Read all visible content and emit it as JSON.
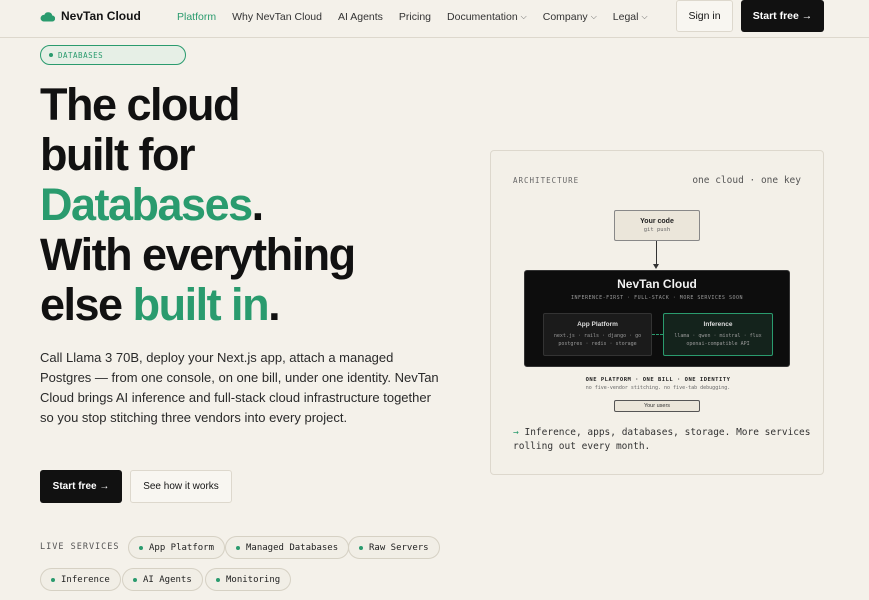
{
  "nav": {
    "logo": "NevTan Cloud",
    "links": [
      {
        "label": "Platform",
        "active": true,
        "dropdown": false
      },
      {
        "label": "Why NevTan Cloud",
        "active": false,
        "dropdown": false
      },
      {
        "label": "AI Agents",
        "active": false,
        "dropdown": false
      },
      {
        "label": "Pricing",
        "active": false,
        "dropdown": false
      },
      {
        "label": "Documentation",
        "active": false,
        "dropdown": true
      },
      {
        "label": "Company",
        "active": false,
        "dropdown": true
      },
      {
        "label": "Legal",
        "active": false,
        "dropdown": true
      }
    ],
    "signin": "Sign in",
    "start": "Start free →"
  },
  "hero": {
    "tag": "DATABASES",
    "h_line1": "The cloud",
    "h_line2": "built for",
    "h_accent": "Databases",
    "h_period": ".",
    "h_line4": "With everything",
    "h_line5a": "else ",
    "h_line5b": "built in",
    "h_line5c": ".",
    "description": "Call Llama 3 70B, deploy your Next.js app, attach a managed Postgres — from one console, on one bill, under one identity. NevTan Cloud brings AI inference and full-stack cloud infrastructure together so you stop stitching three vendors into every project.",
    "cta_primary": "Start free →",
    "cta_secondary": "See how it works",
    "live_label": "LIVE SERVICES",
    "services": [
      "App Platform",
      "Managed Databases",
      "Raw Servers",
      "Inference",
      "AI Agents",
      "Monitoring"
    ]
  },
  "arch": {
    "label": "ARCHITECTURE",
    "right": "one cloud · one key",
    "code_title": "Your code",
    "code_sub": "git push",
    "cloud_title": "NevTan Cloud",
    "cloud_sub": "INFERENCE-FIRST · FULL-STACK · MORE SERVICES SOON",
    "app_title": "App Platform",
    "app_line1": "next.js · rails · django · go",
    "app_line2": "postgres · redis · storage",
    "inf_title": "Inference",
    "inf_line1": "llama · qwen · mistral · flux",
    "inf_line2": "openai-compatible API",
    "one_platform": "ONE PLATFORM · ONE BILL · ONE IDENTITY",
    "no_five": "no five-vendor stitching. no five-tab debugging.",
    "users": "Your users",
    "foot_arrow": "→",
    "foot": "Inference, apps, databases, storage. More services rolling out every month."
  },
  "colors": {
    "accent": "#2a9b6e",
    "background": "#f4f1ea",
    "dark": "#111111"
  }
}
